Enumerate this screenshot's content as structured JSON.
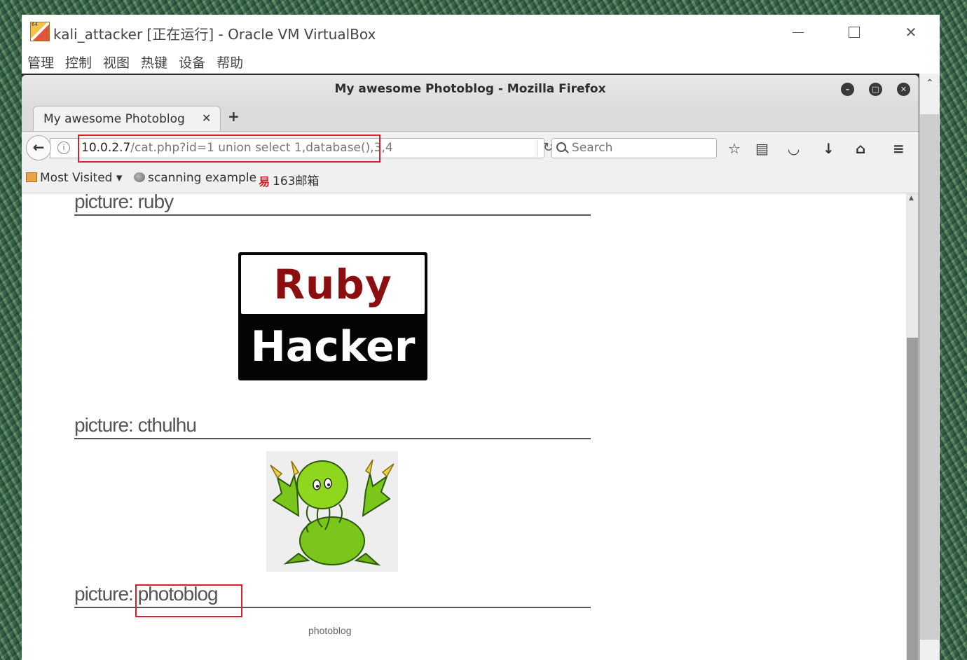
{
  "vbox": {
    "title": "kali_attacker [正在运行] - Oracle VM VirtualBox",
    "menu": [
      "管理",
      "控制",
      "视图",
      "热键",
      "设备",
      "帮助"
    ]
  },
  "firefox": {
    "window_title": "My awesome Photoblog - Mozilla Firefox",
    "tab_title": "My awesome Photoblog",
    "url_host": "10.0.2.7",
    "url_rest": "/cat.php?id=1 union select 1,database(),3,4",
    "search_placeholder": "Search",
    "bookmarks": [
      "Most Visited ▾",
      "scanning example",
      "163邮箱"
    ]
  },
  "page": {
    "sections": [
      {
        "heading": "picture: ruby"
      },
      {
        "heading": "picture: cthulhu"
      },
      {
        "heading": "picture: photoblog"
      }
    ],
    "ruby_logo": {
      "top": "Ruby",
      "bottom": "Hacker"
    },
    "caption": "photoblog"
  },
  "colors": {
    "highlight": "#d9202a",
    "ruby_red": "#8b0f10"
  }
}
